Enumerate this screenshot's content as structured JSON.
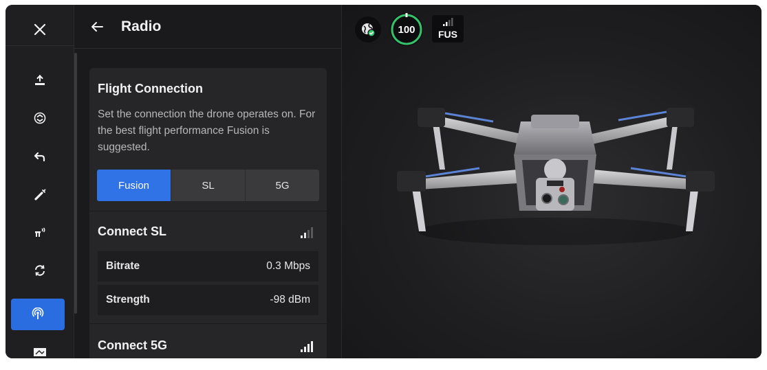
{
  "header": {
    "title": "Radio"
  },
  "flight_connection": {
    "title": "Flight Connection",
    "description": "Set the connection the drone operates on. For the best flight performance Fusion is suggested.",
    "options": [
      "Fusion",
      "SL",
      "5G"
    ],
    "selected": "Fusion"
  },
  "connect_sl": {
    "title": "Connect SL",
    "rows": [
      {
        "label": "Bitrate",
        "value": "0.3 Mbps"
      },
      {
        "label": "Strength",
        "value": "-98 dBm"
      }
    ]
  },
  "connect_5g": {
    "title": "Connect 5G"
  },
  "status": {
    "battery": "100",
    "link": "FUS"
  },
  "colors": {
    "accent": "#2f73e6",
    "battery_ring": "#35c26b",
    "connected_badge": "#35c26b"
  },
  "icons": {
    "rail": [
      "close-icon",
      "takeoff-icon",
      "land-icon",
      "return-home-icon",
      "laser-pointer-icon",
      "obstacle-avoidance-icon",
      "rotate-sync-icon",
      "radio-icon",
      "display-icon"
    ]
  }
}
